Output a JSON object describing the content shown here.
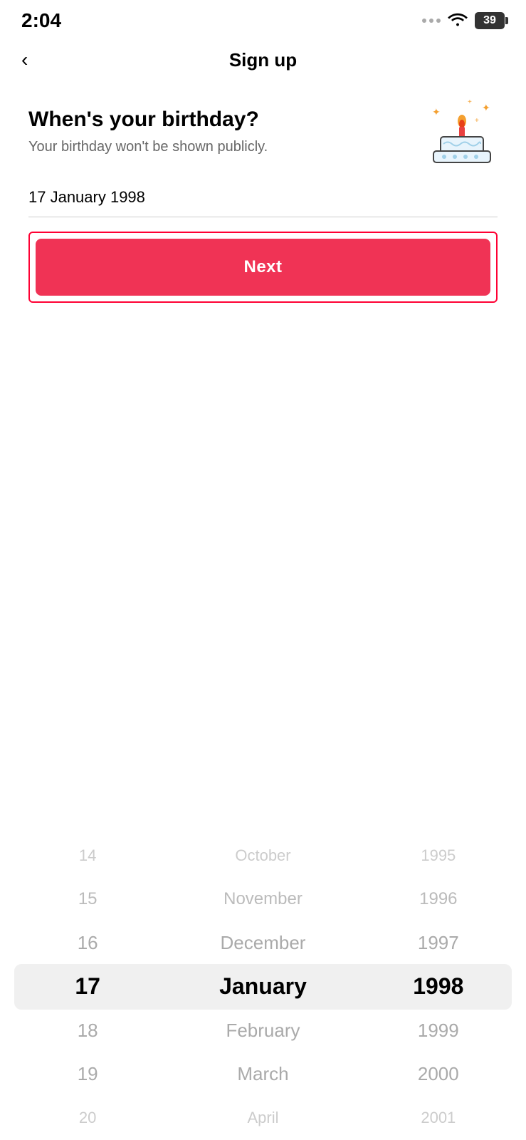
{
  "statusBar": {
    "time": "2:04",
    "battery": "39"
  },
  "nav": {
    "back_label": "‹",
    "title": "Sign up"
  },
  "header": {
    "question": "When's your birthday?",
    "subtitle": "Your birthday won't be shown publicly."
  },
  "selectedDate": "17 January 1998",
  "nextButton": {
    "label": "Next"
  },
  "picker": {
    "days": [
      "14",
      "15",
      "16",
      "17",
      "18",
      "19",
      "20"
    ],
    "months": [
      "October",
      "November",
      "December",
      "January",
      "February",
      "March",
      "April"
    ],
    "years": [
      "1995",
      "1996",
      "1997",
      "1998",
      "1999",
      "2000",
      "2001"
    ],
    "selectedIndex": 3
  }
}
